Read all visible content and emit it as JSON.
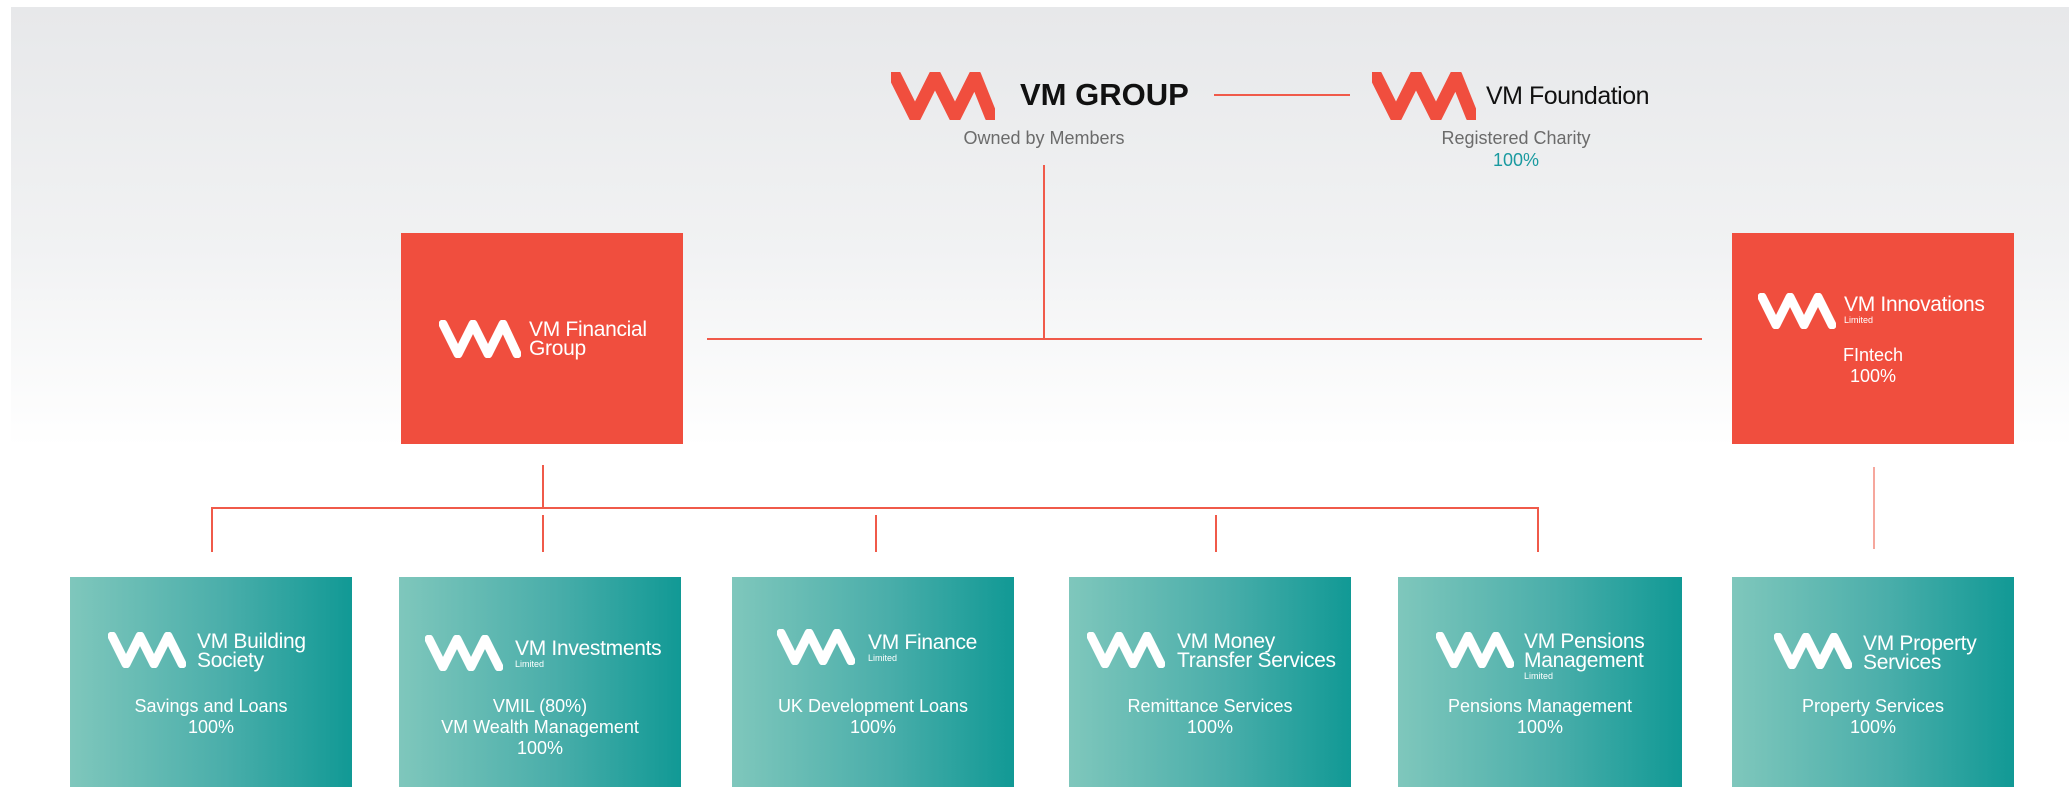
{
  "colors": {
    "brand_red": "#f04e3e",
    "line_red": "#f05a4a",
    "teal_dark": "#119995",
    "teal_light": "#7fc7bc",
    "percent_teal": "#1a9aa0"
  },
  "header": {
    "group": {
      "title": "VM GROUP",
      "subtitle": "Owned by Members"
    },
    "foundation": {
      "title": "VM Foundation",
      "subtitle": "Registered Charity",
      "percent": "100%"
    }
  },
  "level2": {
    "financial_group": {
      "name_line1": "VM Financial",
      "name_line2": "Group"
    },
    "innovations": {
      "name": "VM Innovations",
      "suffix": "Limited",
      "desc": "FIntech",
      "percent": "100%"
    }
  },
  "subsidiaries": [
    {
      "name_line1": "VM Building",
      "name_line2": "Society",
      "suffix": "",
      "desc_lines": [
        "Savings and Loans",
        "100%"
      ]
    },
    {
      "name_line1": "VM Investments",
      "name_line2": "",
      "suffix": "Limited",
      "desc_lines": [
        "VMIL (80%)",
        "VM Wealth Management",
        "100%"
      ]
    },
    {
      "name_line1": "VM Finance",
      "name_line2": "",
      "suffix": "Limited",
      "desc_lines": [
        "UK Development Loans",
        "100%"
      ]
    },
    {
      "name_line1": "VM Money",
      "name_line2": "Transfer Services",
      "suffix": "",
      "desc_lines": [
        "Remittance Services",
        "100%"
      ]
    },
    {
      "name_line1": "VM Pensions",
      "name_line2": "Management",
      "suffix": "Limited",
      "desc_lines": [
        "Pensions Management",
        "100%"
      ]
    },
    {
      "name_line1": "VM Property",
      "name_line2": "Services",
      "suffix": "",
      "desc_lines": [
        "Property Services",
        "100%"
      ]
    }
  ]
}
